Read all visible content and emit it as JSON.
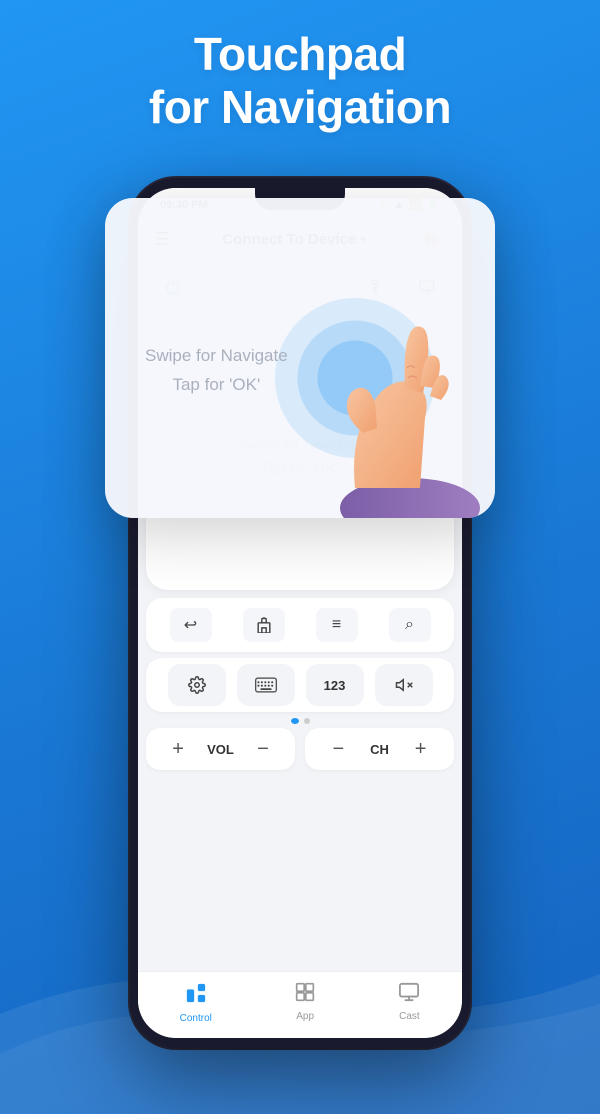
{
  "hero": {
    "line1": "Touchpad",
    "line2": "for Navigation"
  },
  "status_bar": {
    "time": "09:30 PM",
    "icons": "bluetooth wifi signal battery"
  },
  "header": {
    "title": "Connect To Device",
    "chevron": "▾"
  },
  "touchpad": {
    "hint_line1": "Swipe for Navigate",
    "hint_line2": "Tap for 'OK'"
  },
  "nav_buttons": [
    {
      "icon": "↩",
      "label": "back"
    },
    {
      "icon": "⊡",
      "label": "home"
    },
    {
      "icon": "≡",
      "label": "menu"
    },
    {
      "icon": "⌕",
      "label": "search"
    }
  ],
  "action_buttons": [
    {
      "icon": "⚙",
      "label": "settings"
    },
    {
      "icon": "⌨",
      "label": "keyboard"
    },
    {
      "icon": "123",
      "label": "numpad"
    },
    {
      "icon": "🔇",
      "label": "mute"
    }
  ],
  "volume": {
    "plus": "+",
    "label": "VOL",
    "minus": "−"
  },
  "channel": {
    "minus": "−",
    "label": "CH",
    "plus": "+"
  },
  "bottom_nav": [
    {
      "icon": "🎮",
      "label": "Control",
      "active": true
    },
    {
      "icon": "⊞",
      "label": "App",
      "active": false
    },
    {
      "icon": "🖥",
      "label": "Cast",
      "active": false
    }
  ],
  "dots": [
    true,
    false
  ],
  "colors": {
    "brand_blue": "#2196f3",
    "bg_blue": "#1e88e5",
    "active_tab": "#2196f3"
  }
}
